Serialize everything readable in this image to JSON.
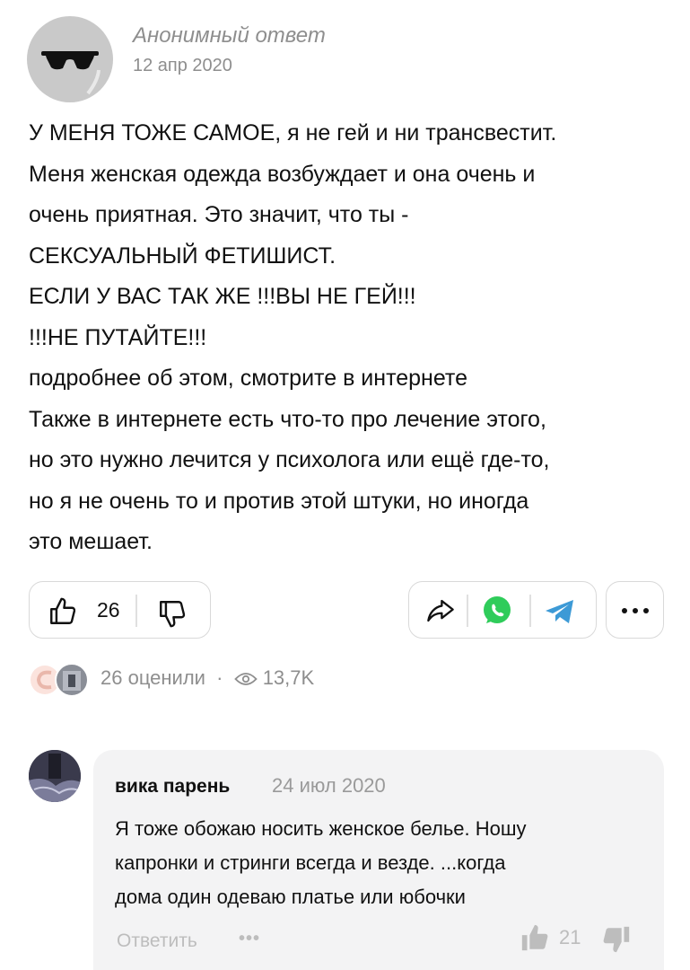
{
  "answer": {
    "author": "Анонимный ответ",
    "date": "12 апр 2020",
    "lines": [
      "У МЕНЯ ТОЖЕ САМОЕ, я не гей и ни трансвестит.",
      "Меня женская одежда возбуждает и она очень и",
      "очень приятная. Это значит, что ты -",
      "СЕКСУАЛЬНЫЙ ФЕТИШИСТ.",
      "ЕСЛИ У ВАС ТАК ЖЕ !!!ВЫ НЕ ГЕЙ!!!",
      "!!!НЕ ПУТАЙТЕ!!!",
      "подробнее об этом, смотрите в интернете",
      "Также в интернете есть что-то про лечение этого,",
      "но это нужно лечится у психолога или ещё где-то,",
      "но я не очень то и против этой штуки, но иногда",
      "это мешает."
    ]
  },
  "actions": {
    "like_count": "26",
    "icons": [
      "thumb-up-icon",
      "thumb-down-icon",
      "share-icon",
      "whatsapp-icon",
      "telegram-icon",
      "more-icon"
    ],
    "colors": {
      "whatsapp": "#2fcc5a",
      "telegram": "#3d9ad6",
      "border": "#d9d9d9"
    }
  },
  "stats": {
    "rated": "26 оценили",
    "separator": "·",
    "views": "13,7K"
  },
  "comment": {
    "author": "вика парень",
    "date": "24 июл 2020",
    "lines": [
      "Я тоже обожаю носить женское белье. Ношу",
      "капронки и стринги всегда и везде. ...когда",
      "дома один одеваю платье или юбочки"
    ],
    "reply_label": "Ответить",
    "more_dots": "•••",
    "likes": "21"
  }
}
